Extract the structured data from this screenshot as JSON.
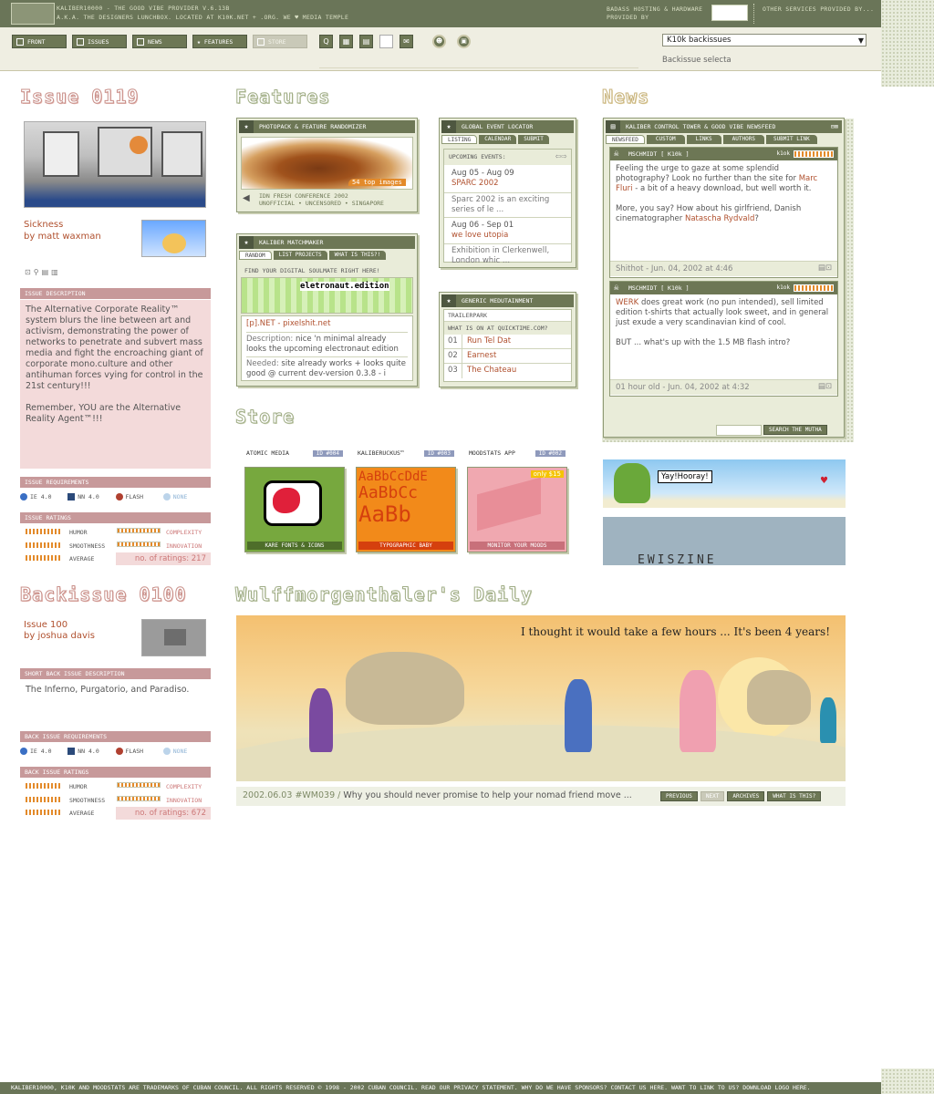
{
  "header": {
    "line1": "KALIBER10000 - THE GOOD VIBE PROVIDER v.6.13b",
    "line2": "A.K.A. THE DESIGNERS LUNCHBOX. LOCATED AT K10K.NET + .ORG. WE ♥ MEDIA TEMPLE",
    "hosting1": "BADASS HOSTING & HARDWARE",
    "hosting2": "PROVIDED BY",
    "other": "OTHER SERVICES PROVIDED BY..."
  },
  "nav": {
    "items": [
      "FRONT",
      "ISSUES",
      "NEWS",
      "FEATURES",
      "STORE"
    ],
    "backissue_select": "K10k backissues",
    "backissue_caption": "Backissue selecta"
  },
  "issue": {
    "heading": "Issue 0119",
    "title": "Sickness",
    "author": "by matt waxman",
    "desc_label": "ISSUE DESCRIPTION",
    "desc": "The Alternative Corporate Reality™ system blurs the line between art and activism, demonstrating the power of networks to penetrate and subvert mass media and fight the encroaching giant of corporate mono.culture and other antihuman forces vying for control in the 21st century!!!",
    "desc2": "Remember, YOU are the Alternative Reality Agent™!!!",
    "req_label": "ISSUE REQUIREMENTS",
    "reqs": [
      "IE 4.0",
      "NN 4.0",
      "FLASH",
      "NONE"
    ],
    "ratings_label": "ISSUE RATINGS",
    "ratings": {
      "humor": "HUMOR",
      "complexity": "COMPLEXITY",
      "smoothness": "SMOOTHNESS",
      "innovation": "INNOVATION",
      "average": "AVERAGE"
    },
    "num_ratings": "no. of ratings: 217"
  },
  "backissue": {
    "heading": "Backissue 0100",
    "title": "Issue 100",
    "author": "by joshua davis",
    "desc_label": "SHORT BACK ISSUE DESCRIPTION",
    "desc": "The Inferno, Purgatorio, and Paradiso.",
    "req_label": "BACK ISSUE REQUIREMENTS",
    "reqs": [
      "IE 4.0",
      "NN 4.0",
      "FLASH",
      "NONE"
    ],
    "ratings_label": "BACK ISSUE RATINGS",
    "ratings": {
      "humor": "HUMOR",
      "complexity": "COMPLEXITY",
      "smoothness": "SMOOTHNESS",
      "innovation": "INNOVATION",
      "average": "AVERAGE"
    },
    "num_ratings": "no. of ratings: 672"
  },
  "features": {
    "heading": "Features",
    "photopack": {
      "title": "PHOTOPACK & FEATURE RANDOMIZER",
      "badge": "54 top images",
      "caption1": "IdN FRESH CONFERENCE 2002",
      "caption2": "UNOFFICIAL • UNCENSORED • SINGAPORE"
    },
    "matchmaker": {
      "title": "KALIBER MATCHMAKER",
      "tabs": [
        "RANDOM",
        "LIST PROJECTS",
        "WHAT IS THIS?!"
      ],
      "sub": "FIND YOUR DIGITAL SOULMATE RIGHT HERE!",
      "banner": "eletronaut.edition",
      "site": "[p].NET - pixelshit.net",
      "desc_label": "Description:",
      "desc": "nice 'n minimal already looks the upcoming electronaut edition",
      "needed_label": "Needed:",
      "needed": "site already works + looks quite good @ current dev-version 0.3.8 - i"
    },
    "events": {
      "title": "GLOBAL EVENT LOCATOR",
      "tabs": [
        "LISTING",
        "CALENDAR",
        "SUBMIT"
      ],
      "sub": "UPCOMING EVENTS:",
      "items": [
        {
          "date": "Aug 05 - Aug 09",
          "name": "SPARC 2002",
          "desc": "Sparc 2002 is an exciting series of le ..."
        },
        {
          "date": "Aug 06 - Sep 01",
          "name": "we love utopia",
          "desc": "Exhibition in Clerkenwell, London whic ..."
        }
      ]
    },
    "medutainment": {
      "title": "GENERIC MEDUTAINMENT",
      "tab": "TRAILERPARK",
      "sub": "WHAT IS ON AT QUICKTIME.COM?",
      "items": [
        {
          "n": "01",
          "name": "Run Tel Dat"
        },
        {
          "n": "02",
          "name": "Earnest"
        },
        {
          "n": "03",
          "name": "The Chateau"
        }
      ]
    }
  },
  "store": {
    "heading": "Store",
    "items": [
      {
        "name": "ATOMIC MEDIA",
        "id": "ID #004",
        "caption": "KARE FONTS & ICONS"
      },
      {
        "name": "KALIBERUCKUS™",
        "id": "ID #003",
        "caption": "TYPOGRAPHIC BABY",
        "art": [
          "AaBbCcDdE",
          "AaBbCc",
          "AaBb"
        ]
      },
      {
        "name": "MOODSTATS APP",
        "id": "ID #002",
        "caption": "MONITOR YOUR MOODS",
        "badge": "only $15"
      }
    ]
  },
  "news": {
    "heading": "News",
    "panel_title": "KALIBER CONTROL TOWER & GOOD VIBE NEWSFEED",
    "tabs": [
      "NEWSFEED",
      "CUSTOM",
      "LINKS",
      "AUTHORS",
      "SUBMIT LINK"
    ],
    "posts": [
      {
        "author": "MSCHMIDT [ K10k ]",
        "k": "k1ok",
        "p1a": "Feeling the urge to gaze at some splendid photography? Look no further than the site for ",
        "link1": "Marc Fluri",
        "p1b": " - a bit of a heavy download, but well worth it.",
        "p2a": "More, you say? How about his girlfriend, Danish cinematographer ",
        "link2": "Natascha Rydvald",
        "p2b": "?",
        "footer": "Shithot - Jun. 04, 2002 at 4:46"
      },
      {
        "author": "MSCHMIDT [ K10k ]",
        "k": "k1ok",
        "link1": "WERK",
        "p1b": " does great work (no pun intended), sell limited edition t-shirts that actually look sweet, and in general just exude a very scandinavian kind of cool.",
        "p2a": "BUT ... what's up with the 1.5 MB flash intro?",
        "footer": "01 hour old - Jun. 04, 2002 at 4:32"
      }
    ],
    "search_btn": "SEARCH THE MUTHA",
    "ad1": "Yay!Hooray!",
    "ad2": "EWISZINE"
  },
  "comic": {
    "heading": "Wulffmorgenthaler's Daily",
    "speech": "I thought it would take a few hours ... It's been 4 years!",
    "date": "2002.06.03",
    "code": "#WM039",
    "sep": "/",
    "caption": "Why you should never promise to help your nomad friend move ...",
    "buttons": [
      "PREVIOUS",
      "NEXT",
      "ARCHIVES",
      "WHAT IS THIS?"
    ]
  },
  "footer": "KALIBER10000, K10k AND MOODSTATS ARE TRADEMARKS OF CUBAN COUNCIL. ALL RIGHTS RESERVED © 1998 - 2002 CUBAN COUNCIL. READ OUR PRIVACY STATEMENT. WHY DO WE HAVE SPONSORS? CONTACT US HERE. WANT TO LINK TO US? DOWNLOAD LOGO HERE."
}
